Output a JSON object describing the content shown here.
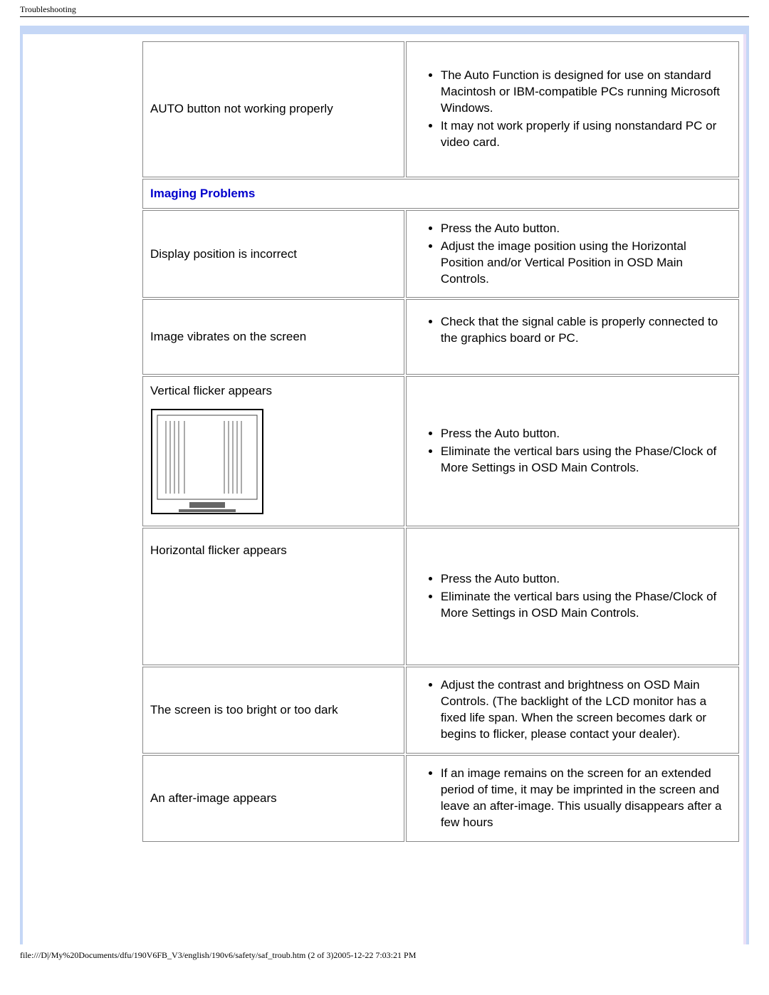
{
  "header": "Troubleshooting",
  "footer": "file:///D|/My%20Documents/dfu/190V6FB_V3/english/190v6/safety/saf_troub.htm (2 of 3)2005-12-22 7:03:21 PM",
  "section_header": "Imaging Problems",
  "rows": [
    {
      "problem": "AUTO button not working properly",
      "bullets": [
        "The Auto Function is designed for use on standard Macintosh or IBM-compatible PCs running Microsoft Windows.",
        "It may not work properly if using nonstandard PC or video card."
      ]
    },
    {
      "problem": "Display position is incorrect",
      "bullets": [
        "Press the Auto button.",
        "Adjust the image position using the Horizontal Position and/or Vertical Position in OSD Main Controls."
      ]
    },
    {
      "problem": "Image vibrates on the screen",
      "bullets": [
        "Check that the signal cable is properly connected to the graphics board or PC."
      ]
    },
    {
      "problem": "Vertical flicker appears",
      "bullets": [
        "Press the Auto button.",
        "Eliminate the vertical bars using the Phase/Clock of More Settings in OSD Main Controls."
      ]
    },
    {
      "problem": "Horizontal flicker appears",
      "bullets": [
        "Press the Auto button.",
        "Eliminate the vertical bars using the Phase/Clock of More Settings in OSD Main Controls."
      ]
    },
    {
      "problem": "The screen is too bright or too dark",
      "bullets": [
        "Adjust the contrast and brightness on OSD Main Controls. (The backlight of the LCD monitor has a fixed life span. When the screen becomes dark or begins to flicker, please contact your dealer)."
      ]
    },
    {
      "problem": "An after-image appears",
      "bullets": [
        "If an image remains on the screen for an extended period of time, it may be imprinted in the screen and leave an after-image. This usually disappears after a few hours"
      ]
    }
  ]
}
